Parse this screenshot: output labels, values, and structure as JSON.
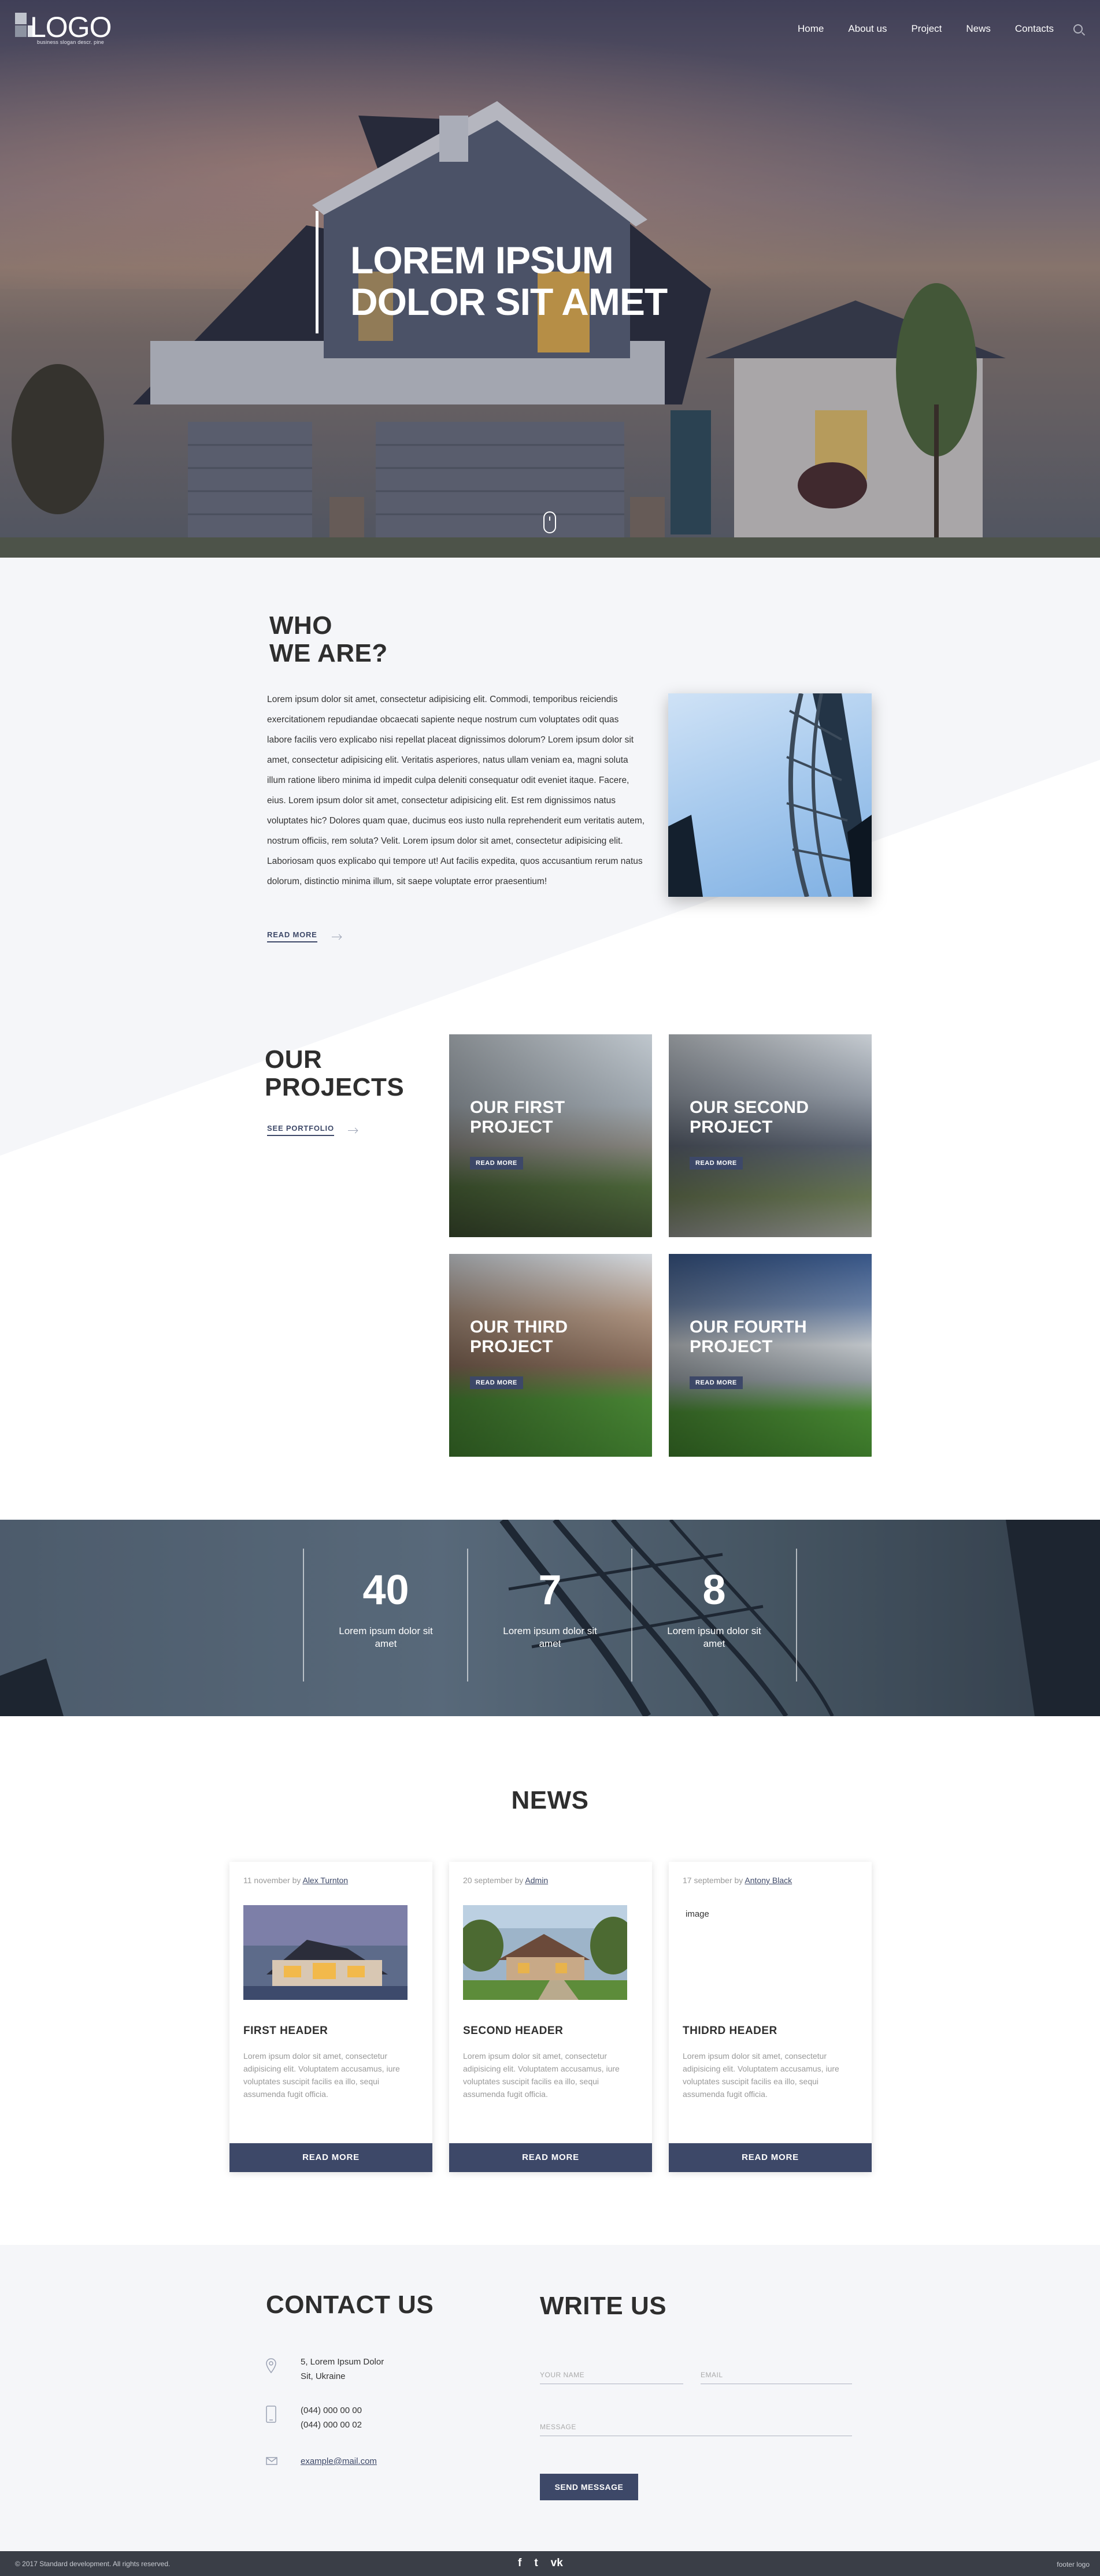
{
  "header": {
    "logo": {
      "text": "LOGO",
      "tagline": "business slogan descr. pine"
    },
    "nav": [
      {
        "label": "Home"
      },
      {
        "label": "About us"
      },
      {
        "label": "Project"
      },
      {
        "label": "News"
      },
      {
        "label": "Contacts"
      }
    ]
  },
  "hero": {
    "title_line1": "LOREM IPSUM",
    "title_line2": "DOLOR SIT AMET"
  },
  "about": {
    "title_line1": "WHO",
    "title_line2": "WE ARE?",
    "text": "Lorem ipsum dolor sit amet, consectetur adipisicing elit. Commodi, temporibus reiciendis exercitationem repudiandae obcaecati sapiente neque nostrum cum voluptates odit quas labore facilis vero explicabo nisi repellat placeat dignissimos dolorum? Lorem ipsum dolor sit amet, consectetur adipisicing elit. Veritatis asperiores, natus ullam veniam ea, magni soluta illum ratione libero minima id impedit culpa deleniti consequatur odit eveniet itaque. Facere, eius. Lorem ipsum dolor sit amet, consectetur adipisicing elit. Est rem dignissimos natus voluptates hic? Dolores quam quae, ducimus eos iusto nulla reprehenderit eum veritatis autem, nostrum officiis, rem soluta? Velit. Lorem ipsum dolor sit amet, consectetur adipisicing elit. Laboriosam quos explicabo qui tempore ut! Aut facilis expedita, quos accusantium rerum natus dolorum, distinctio minima illum, sit saepe voluptate error praesentium!",
    "read_more": "READ MORE"
  },
  "projects": {
    "title_line1": "OUR",
    "title_line2": "PROJECTS",
    "see_portfolio": "SEE PORTFOLIO",
    "items": [
      {
        "line1": "OUR FIRST",
        "line2": "PROJECT",
        "button": "READ MORE"
      },
      {
        "line1": "OUR SECOND",
        "line2": "PROJECT",
        "button": "READ MORE"
      },
      {
        "line1": "OUR THIRD",
        "line2": "PROJECT",
        "button": "READ MORE"
      },
      {
        "line1": "OUR FOURTH",
        "line2": "PROJECT",
        "button": "READ MORE"
      }
    ]
  },
  "stats": [
    {
      "value": "40",
      "label": "Lorem ipsum dolor sit amet"
    },
    {
      "value": "7",
      "label": "Lorem ipsum dolor sit amet"
    },
    {
      "value": "8",
      "label": "Lorem ipsum dolor sit amet"
    }
  ],
  "news": {
    "title": "NEWS",
    "items": [
      {
        "date": "11 november by",
        "author": "Alex Turnton",
        "header": "FIRST HEADER",
        "text": "Lorem ipsum dolor sit amet, consectetur adipisicing elit. Voluptatem accusamus, iure voluptates suscipit facilis ea illo, sequi assumenda fugit officia.",
        "button": "READ MORE"
      },
      {
        "date": "20 september by",
        "author": "Admin",
        "header": "SECOND HEADER",
        "text": "Lorem ipsum dolor sit amet, consectetur adipisicing elit. Voluptatem accusamus, iure voluptates suscipit facilis ea illo, sequi assumenda fugit officia.",
        "button": "READ MORE"
      },
      {
        "date": "17 september by",
        "author": "Antony Black",
        "image_alt": "image",
        "header": "THIDRD HEADER",
        "text": "Lorem ipsum dolor sit amet, consectetur adipisicing elit. Voluptatem accusamus, iure voluptates suscipit facilis ea illo, sequi assumenda fugit officia.",
        "button": "READ MORE"
      }
    ]
  },
  "contact": {
    "title": "CONTACT US",
    "address_line1": "5, Lorem Ipsum Dolor",
    "address_line2": "Sit, Ukraine",
    "phone1": "(044) 000 00 00",
    "phone2": "(044) 000 00 02",
    "email": "example@mail.com"
  },
  "write": {
    "title": "WRITE US",
    "name_placeholder": "YOUR NAME",
    "email_placeholder": "EMAIL",
    "message_placeholder": "MESSAGE",
    "send": "SEND MESSAGE"
  },
  "footer": {
    "copyright": "© 2017 Standard development. All rights reserved.",
    "social": [
      "f",
      "t",
      "vk"
    ],
    "logo": "footer logo"
  },
  "colors": {
    "accent": "#3d4868",
    "footer_bg": "#3a3e47",
    "light_bg": "#f5f6f9"
  }
}
